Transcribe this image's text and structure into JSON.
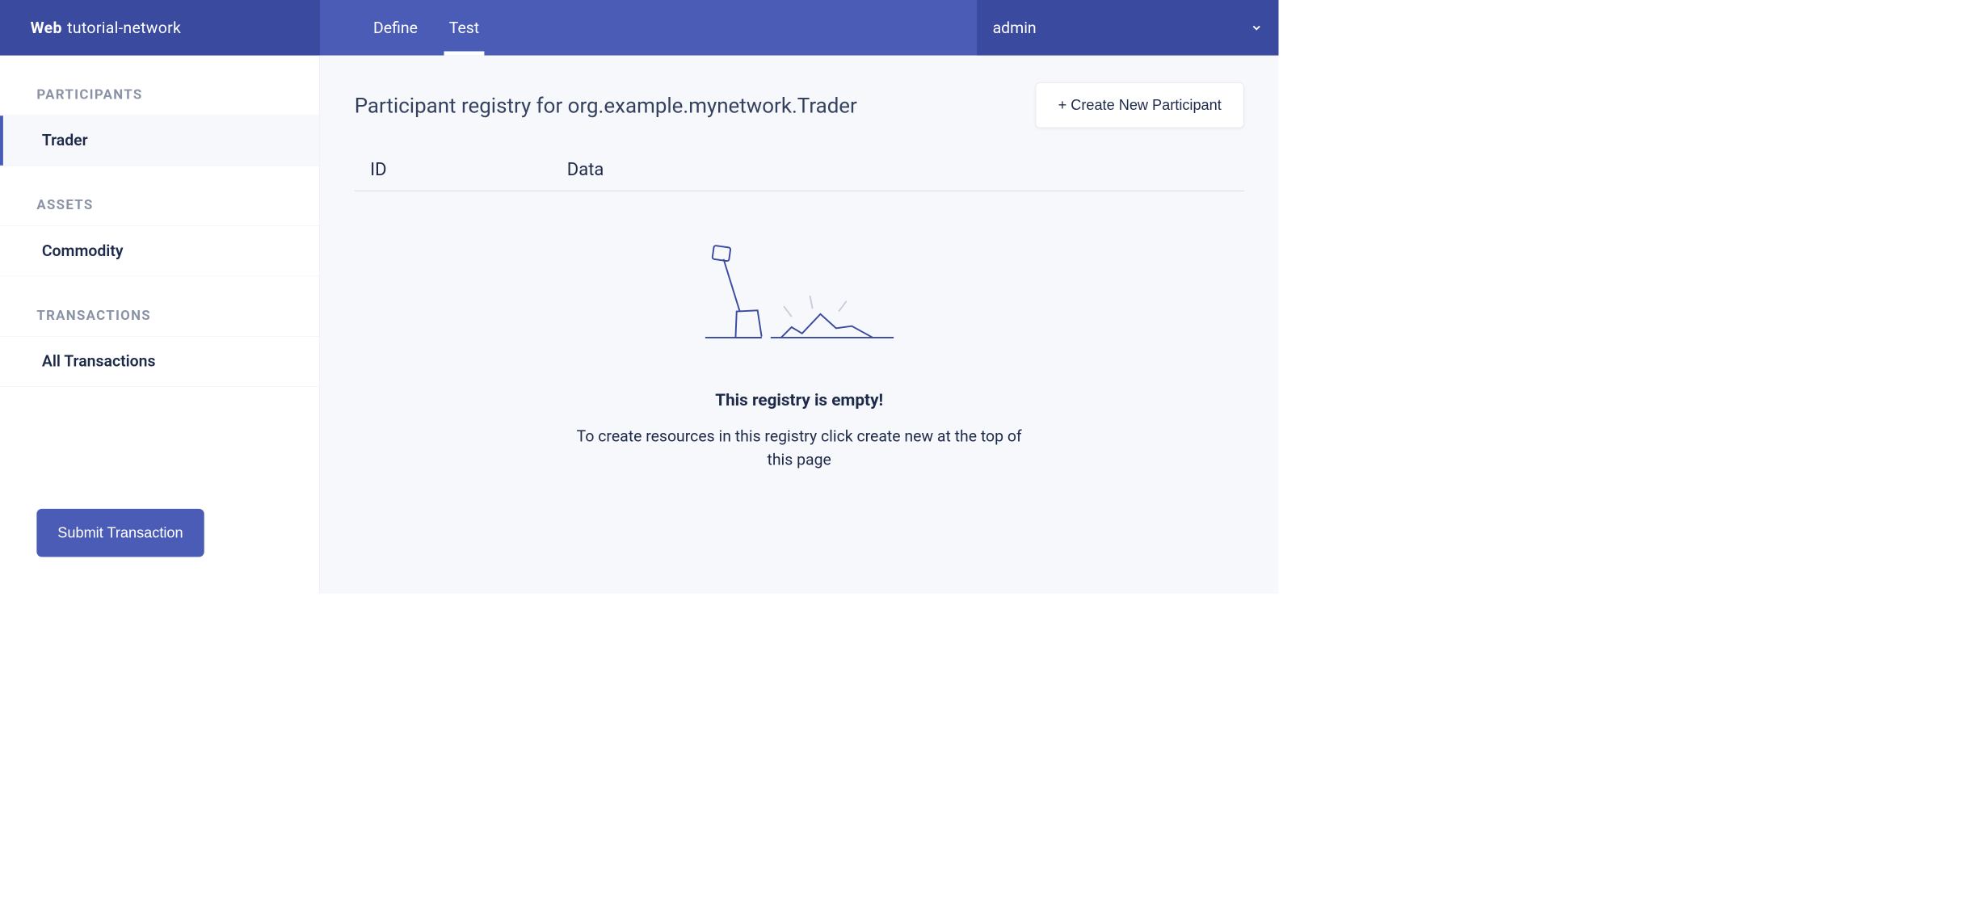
{
  "header": {
    "brand_prefix": "Web",
    "brand_name": "tutorial-network",
    "tabs": [
      {
        "label": "Define",
        "active": false
      },
      {
        "label": "Test",
        "active": true
      }
    ],
    "user": "admin"
  },
  "sidebar": {
    "sections": [
      {
        "header": "PARTICIPANTS",
        "items": [
          {
            "label": "Trader",
            "active": true
          }
        ]
      },
      {
        "header": "ASSETS",
        "items": [
          {
            "label": "Commodity",
            "active": false
          }
        ]
      },
      {
        "header": "TRANSACTIONS",
        "items": [
          {
            "label": "All Transactions",
            "active": false
          }
        ]
      }
    ],
    "submit_label": "Submit Transaction"
  },
  "main": {
    "title": "Participant registry for org.example.mynetwork.Trader",
    "create_button": "+ Create New Participant",
    "columns": {
      "id": "ID",
      "data": "Data"
    },
    "empty": {
      "title": "This registry is empty!",
      "desc": "To create resources in this registry click create new at the top of this page"
    }
  }
}
